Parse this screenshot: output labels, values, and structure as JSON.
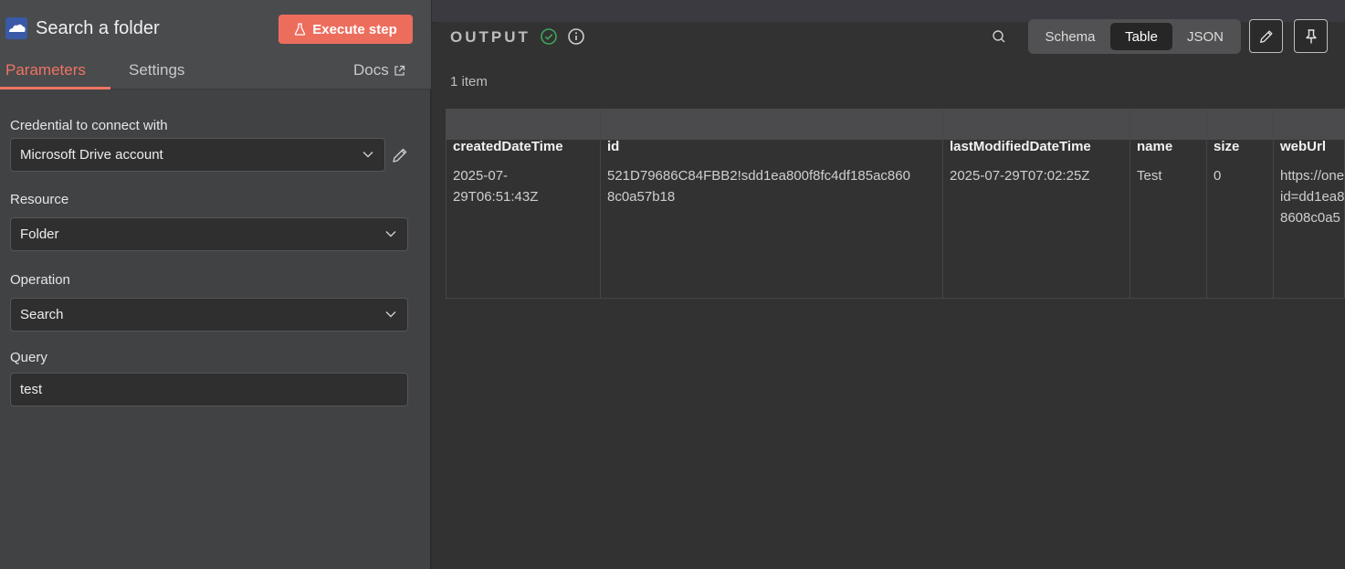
{
  "node": {
    "title": "Search a folder",
    "execute_label": "Execute step"
  },
  "tabs": {
    "parameters": "Parameters",
    "settings": "Settings",
    "docs": "Docs"
  },
  "form": {
    "credential_label": "Credential to connect with",
    "credential_value": "Microsoft Drive account",
    "resource_label": "Resource",
    "resource_value": "Folder",
    "operation_label": "Operation",
    "operation_value": "Search",
    "query_label": "Query",
    "query_value": "test"
  },
  "output": {
    "title": "OUTPUT",
    "item_count": "1 item",
    "views": [
      "Schema",
      "Table",
      "JSON"
    ],
    "active_view": "Table"
  },
  "table": {
    "columns": [
      "createdDateTime",
      "id",
      "lastModifiedDateTime",
      "name",
      "size",
      "webUrl"
    ],
    "row": {
      "createdDateTime_1": "2025-07-",
      "createdDateTime_2": "29T06:51:43Z",
      "id_1": "521D79686C84FBB2!sdd1ea800f8fc4df185ac860",
      "id_2": "8c0a57b18",
      "lastModifiedDateTime": "2025-07-29T07:02:25Z",
      "name": "Test",
      "size": "0",
      "webUrl_1": "https://one",
      "webUrl_2": "id=dd1ea8",
      "webUrl_3": "8608c0a5"
    }
  },
  "colors": {
    "accent": "#ed6d5d",
    "success": "#3fa55b"
  }
}
